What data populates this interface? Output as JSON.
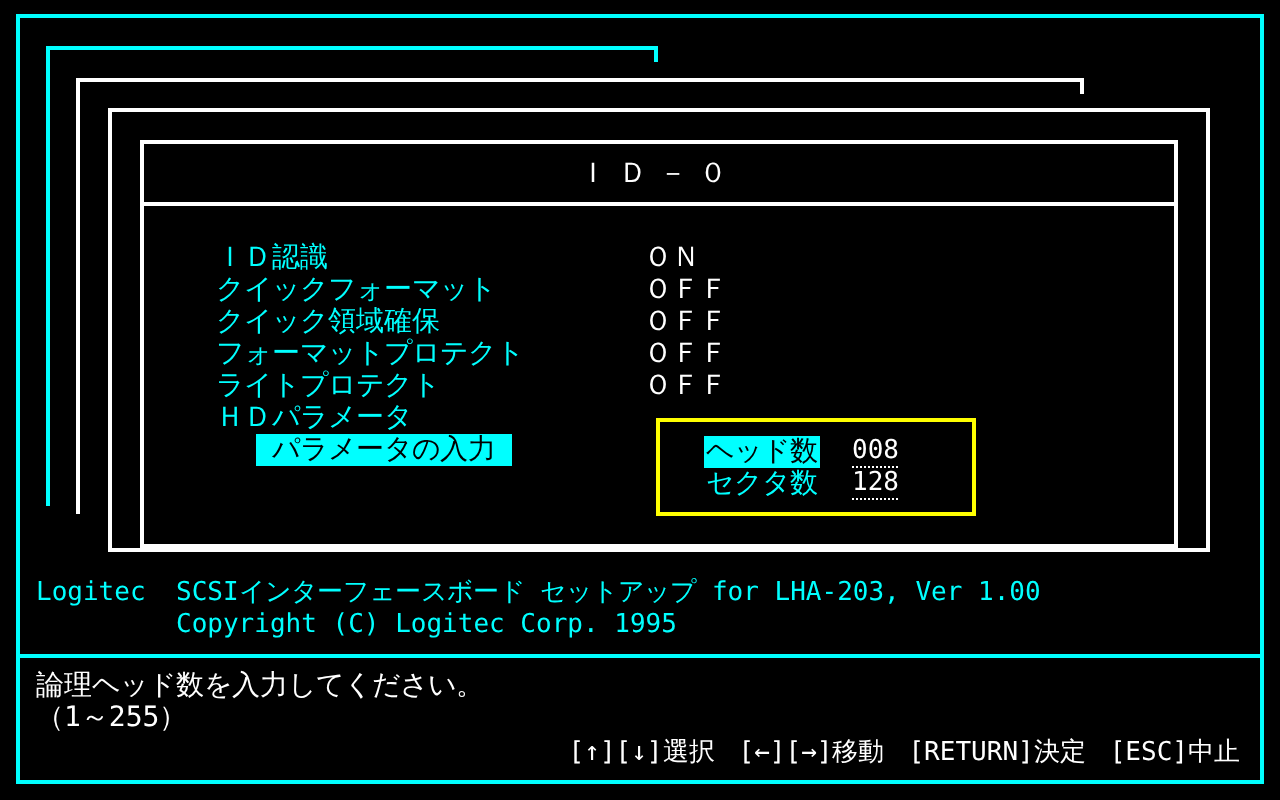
{
  "dialog": {
    "title": "ＩＤ－０",
    "settings": [
      {
        "label": "ＩＤ認識",
        "value": "ＯＮ"
      },
      {
        "label": "クイックフォーマット",
        "value": "ＯＦＦ"
      },
      {
        "label": "クイック領域確保",
        "value": "ＯＦＦ"
      },
      {
        "label": "フォーマットプロテクト",
        "value": "ＯＦＦ"
      },
      {
        "label": "ライトプロテクト",
        "value": "ＯＦＦ"
      }
    ],
    "section": "ＨＤパラメータ",
    "input_button": {
      "label": "パラメータの入力",
      "selected": true
    },
    "params": [
      {
        "label": "ヘッド数",
        "value": "008",
        "selected": true
      },
      {
        "label": "セクタ数",
        "value": "128",
        "selected": false
      }
    ]
  },
  "info": {
    "vendor": "Logitec",
    "product": "SCSIインターフェースボード セットアップ for LHA-203, Ver 1.00",
    "copyright": "Copyright (C) Logitec Corp. 1995"
  },
  "status": {
    "message": "論理ヘッド数を入力してください。",
    "range": "（1～255）",
    "keys": [
      "[↑][↓]選択",
      "[←][→]移動",
      "[RETURN]決定",
      "[ESC]中止"
    ]
  }
}
